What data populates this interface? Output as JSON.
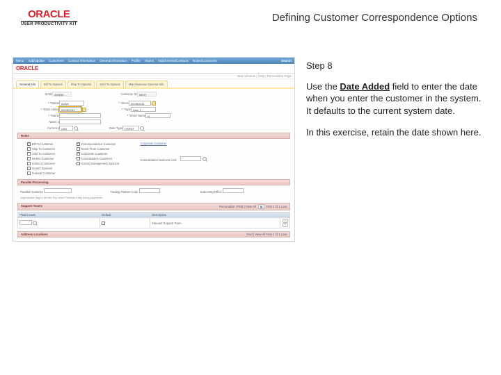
{
  "header": {
    "brand": "ORACLE",
    "subbrand": "USER PRODUCTIVITY KIT",
    "page_title": "Defining Customer Correspondence Options"
  },
  "instruction": {
    "step": "Step 8",
    "line1a": "Use the ",
    "bold": "Date Added",
    "line1b": " field to enter the date when you enter the customer in the system. It defaults to the current system date.",
    "line2": "In this exercise, retain the date shown here."
  },
  "app": {
    "nav": [
      "Menu",
      "Add/Update",
      "Customers",
      "Contact Information",
      "General Information",
      "Profile",
      "Teams",
      "Attachments/Contacts",
      "Notes/Comments",
      "Search"
    ],
    "inner_brand": "ORACLE",
    "userline": "New Window | Help | Personalize Page",
    "tabs": [
      "General Info",
      "Bill To Options",
      "Ship To Options",
      "Sold To Options",
      "Miscellaneous General Info"
    ],
    "active_tab": 0,
    "top": {
      "setid_label": "SetID",
      "setid": "SHARE",
      "custid_label": "Customer ID",
      "custid": "NEXT"
    },
    "row1": {
      "status_label": "*Status",
      "status": "Active",
      "date_label": "*Date Added",
      "date": "02/08/2011",
      "since_label": "*Since",
      "since": "02/08/2011",
      "name1_label": "*Name",
      "name1": "",
      "type_label": "*Type",
      "type": "User 1",
      "shortname_label": "*Short Name",
      "shortname": "N",
      "name2_label": "Name 2",
      "name2": "",
      "cur_label": "Currency",
      "cur": "USD",
      "rate_label": "Rate Type",
      "rate": "CRRNT"
    },
    "roles_label": "Roles",
    "roles_left": [
      "Bill To Customer",
      "Ship To Customer",
      "Sold To Customer",
      "Broker Customer",
      "Indirect Customer",
      "Grants Sponsor",
      "Federal Customer"
    ],
    "roles_right": [
      "Correspondence Customer",
      "Remit From Customer",
      "Corporate Customer",
      "Consolidation Customer",
      "Grants Management Sponsor"
    ],
    "corp_link": "Corporate Customer",
    "corp_options": "Consolidation Business Unit",
    "consol_field": "",
    "support_label": "Parallel Processing",
    "three": {
      "c1_label": "Parallel Customer",
      "c2_label": "Trading Partner Code",
      "c3_label": "Subcontrg Office",
      "note": "Appropriate flag to list the Top Level Federal entity doing payments"
    },
    "st_label": "Support Teams",
    "teams_table": {
      "nav_text": "Personalize | Find | View All",
      "first_last": "First 1 of 1 Last",
      "headers": [
        "*Team Code",
        "Default",
        "Description"
      ],
      "row": [
        "",
        "☐",
        "Inbound Support Team"
      ]
    },
    "addr_label": "Address Locations",
    "addr_nav": "Find | View All   First 1 of 1 Last"
  }
}
